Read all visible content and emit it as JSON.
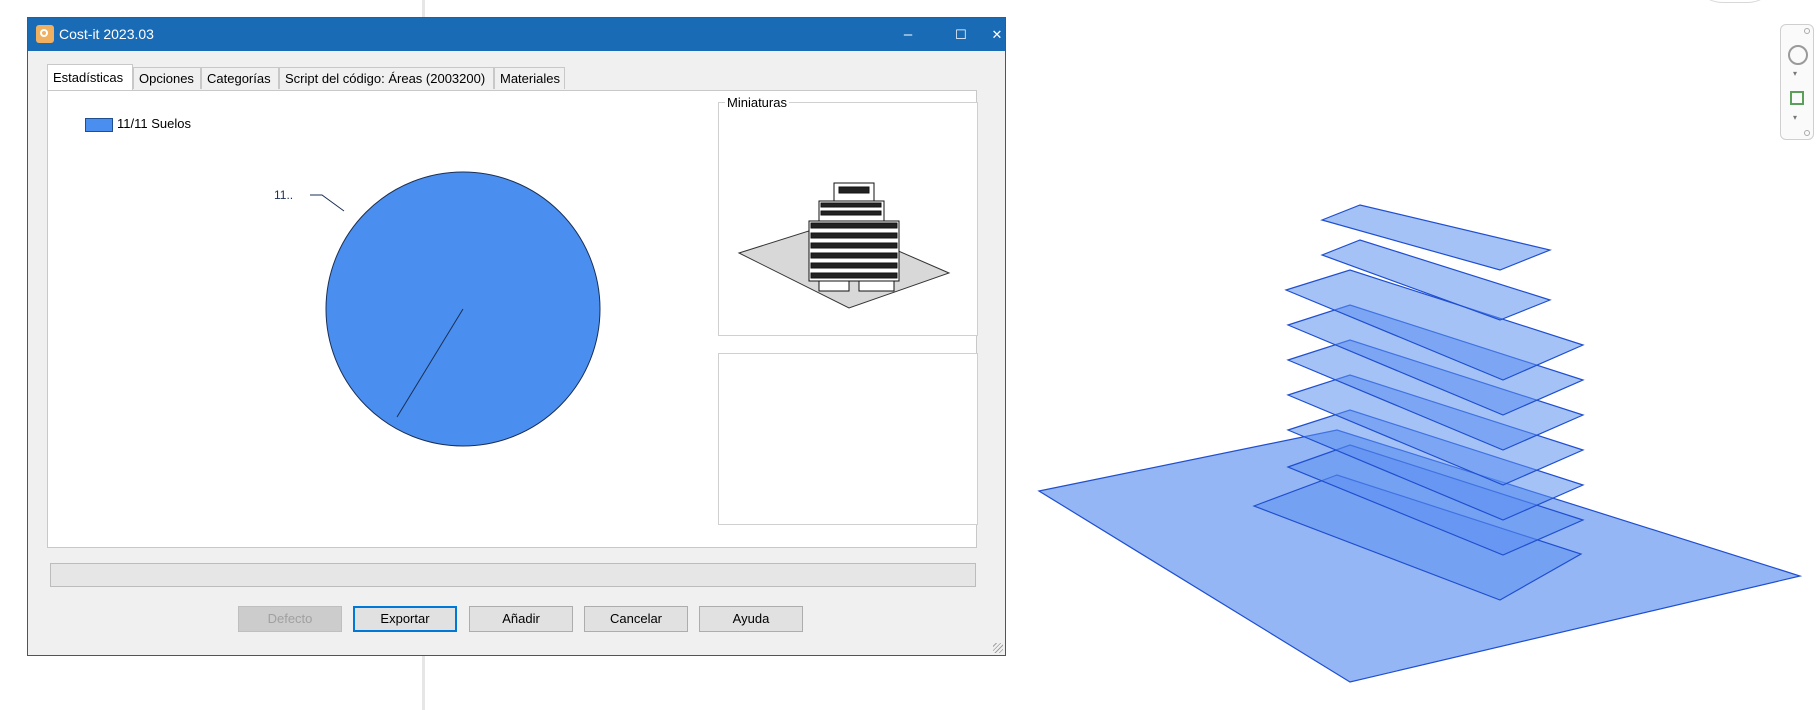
{
  "window": {
    "title": "Cost-it 2023.03",
    "minimize": "‒",
    "maximize": "☐",
    "close": "✕"
  },
  "tabs": [
    {
      "label": "Estadísticas",
      "active": true
    },
    {
      "label": "Opciones",
      "active": false
    },
    {
      "label": "Categorías",
      "active": false
    },
    {
      "label": "Script del código: Áreas (2003200)",
      "active": false
    },
    {
      "label": "Materiales",
      "active": false
    }
  ],
  "legend": {
    "label": "11/11 Suelos",
    "color": "#4a8fef"
  },
  "chart_data": {
    "type": "pie",
    "slices": [
      {
        "name": "11/11 Suelos",
        "value": 11,
        "label": "11..",
        "color": "#4a8fef"
      }
    ]
  },
  "groups": {
    "thumbnails_label": "Miniaturas"
  },
  "buttons": {
    "default": "Defecto",
    "export": "Exportar",
    "add": "Añadir",
    "cancel": "Cancelar",
    "help": "Ayuda"
  },
  "colors": {
    "titlebar": "#1a6bb5",
    "slab_fill": "#5b8ff0",
    "slab_stroke": "#1f4fd0"
  }
}
